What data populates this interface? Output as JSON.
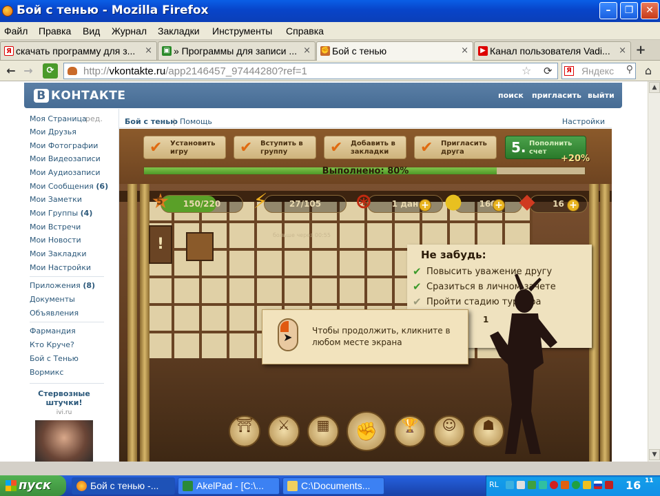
{
  "window": {
    "title": "Бой с тенью - Mozilla Firefox",
    "min_glyph": "–",
    "max_glyph": "❐",
    "close_glyph": "✕"
  },
  "menu": [
    "Файл",
    "Правка",
    "Вид",
    "Журнал",
    "Закладки",
    "Инструменты",
    "Справка"
  ],
  "tabs": [
    {
      "label": "скачать программу для з...",
      "icon": "yandex-icon",
      "icon_glyph": "Я",
      "close": "×",
      "active": false
    },
    {
      "label": "» Программы для записи ...",
      "icon": "site-icon",
      "icon_glyph": "▣",
      "close": "×",
      "active": false
    },
    {
      "label": "Бой с тенью",
      "icon": "fist-icon",
      "icon_glyph": "✊",
      "close": "×",
      "active": true
    },
    {
      "label": "Канал пользователя Vadi...",
      "icon": "youtube-icon",
      "icon_glyph": "▶",
      "close": "×",
      "active": false
    }
  ],
  "new_tab_glyph": "+",
  "nav": {
    "back_glyph": "←",
    "forward_glyph": "→",
    "url_prefix": "http://",
    "url_host": "vkontakte.ru",
    "url_path": "/app2146457_97444280?ref=1",
    "star_glyph": "☆",
    "reload_glyph": "⟳",
    "search_placeholder": "Яндекс",
    "search_engine_glyph": "Я",
    "search_glyph": "⚲",
    "home_glyph": "⌂"
  },
  "vk": {
    "logo_letter": "B",
    "logo_text": "КОНТАКТЕ",
    "header_links": [
      "поиск",
      "пригласить",
      "выйти"
    ],
    "left_nav": [
      {
        "label": "Моя Страница",
        "count": ""
      },
      {
        "label": "Мои Друзья",
        "count": ""
      },
      {
        "label": "Мои Фотографии",
        "count": ""
      },
      {
        "label": "Мои Видеозаписи",
        "count": ""
      },
      {
        "label": "Мои Аудиозаписи",
        "count": ""
      },
      {
        "label": "Мои Сообщения",
        "count": "(6)"
      },
      {
        "label": "Мои Заметки",
        "count": ""
      },
      {
        "label": "Мои Группы",
        "count": "(4)"
      },
      {
        "label": "Мои Встречи",
        "count": ""
      },
      {
        "label": "Мои Новости",
        "count": ""
      },
      {
        "label": "Мои Закладки",
        "count": ""
      },
      {
        "label": "Мои Настройки",
        "count": ""
      }
    ],
    "edit_label": "ред.",
    "left_nav_2": [
      {
        "label": "Приложения",
        "count": "(8)"
      },
      {
        "label": "Документы",
        "count": ""
      },
      {
        "label": "Объявления",
        "count": ""
      }
    ],
    "left_nav_3": [
      "Фармандия",
      "Кто Круче?",
      "Бой с Тенью",
      "Вормикс"
    ],
    "ad_title": "Стервозные штучки!",
    "ad_source": "ivi.ru",
    "app_name": "Бой с тенью",
    "app_sep": "|",
    "app_help": "Помощь",
    "app_settings": "Настройки"
  },
  "game": {
    "tasks": [
      {
        "label": "Установить игру",
        "check": "✔"
      },
      {
        "label": "Вступить в группу",
        "check": "✔"
      },
      {
        "label": "Добавить в закладки",
        "check": "✔"
      },
      {
        "label": "Пригласить друга",
        "check": "✔"
      }
    ],
    "task5": {
      "num": "5.",
      "label": "Пополнить счет"
    },
    "bonus": "+20%",
    "progress_label": "Выполнено: 80%",
    "progress": 0.8,
    "level": "5",
    "xp": "150/220",
    "xp_fraction": 0.68,
    "energy": "27/105",
    "energy_note": "больше через 00:55",
    "dan": "1 дан",
    "coins": "160",
    "rubies": "16",
    "plus_glyph": "+",
    "board_title": "Не забудь:",
    "board_items": [
      "Повысить уважение другу",
      "Сразиться в личном зачете",
      "Пройти стадию турнира"
    ],
    "board_number": "1",
    "board_check": "✔",
    "dialog_text": "Чтобы продолжить, кликните в любом месте экрана",
    "actions": [
      {
        "name": "house-icon",
        "glyph": "⛩"
      },
      {
        "name": "weapons-icon",
        "glyph": "⚔"
      },
      {
        "name": "chest-icon",
        "glyph": "▦"
      },
      {
        "name": "fist-icon",
        "glyph": "✊"
      },
      {
        "name": "trophy-icon",
        "glyph": "🏆"
      },
      {
        "name": "sensei-icon",
        "glyph": "☺"
      },
      {
        "name": "kick-icon",
        "glyph": "☗"
      }
    ]
  },
  "taskbar": {
    "start": "пуск",
    "tasks": [
      {
        "label": "Бой с тенью -...",
        "active": true
      },
      {
        "label": "AkelPad - [C:\\...",
        "active": false
      },
      {
        "label": "C:\\Documents...",
        "active": false
      }
    ],
    "lang": "RL",
    "clock": "16",
    "clock_small": "11"
  },
  "colors": {
    "vk_blue": "#466c94",
    "link_blue": "#2b587a",
    "accent_orange": "#e06a10",
    "progress_green": "#4e9a28"
  }
}
